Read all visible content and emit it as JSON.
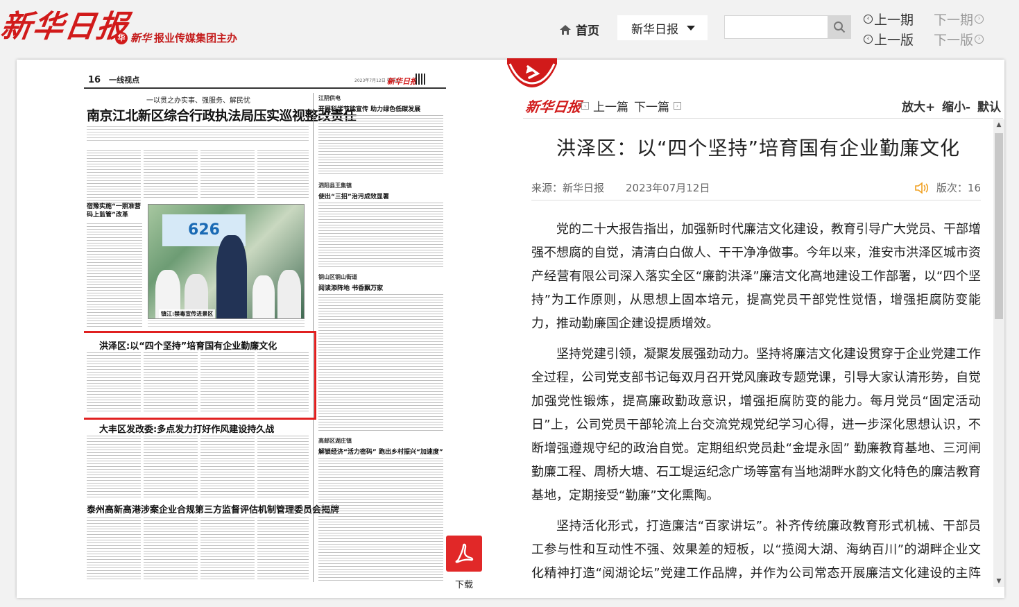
{
  "header": {
    "logo": "新华日报",
    "sponsor_brand": "新华",
    "sponsor_text": "报业传媒集团主办",
    "home": "首页",
    "paper_selected": "新华日报",
    "search_placeholder": "",
    "prev_issue": "上一期",
    "next_issue": "下一期",
    "prev_page": "上一版",
    "next_page": "下一版"
  },
  "newspaper": {
    "page_number": "16",
    "section": "一线视点",
    "date": "2023年7月12日  星期三",
    "brand": "新华日报",
    "lead_subtitle": "一以贯之办实事、强服务、解民忧",
    "lead_title": "南京江北新区综合行政执法局压实巡视整改责任",
    "side_head_1_small": "江阴供电",
    "side_head_1": "开展科学节能宣传  助力绿色低碳发展",
    "side_head_2_small": "泗阳县王集镇",
    "side_head_2": "使出“三招”治污成效显著",
    "side_head_3_small": "铜山区铜山街道",
    "side_head_3": "阅读添阵地  书香飘万家",
    "side_head_4_small": "高邮区湖庄镇",
    "side_head_4": "解锁经济“活力密码”  跑出乡村振兴“加速度”",
    "left_box_title": "宿豫实施“一照准营\n码上监管”改革",
    "photo_sign": "626",
    "photo_caption": "镇江:禁毒宣传进景区",
    "highlight_title": "洪泽区:以“四个坚持”培育国有企业勤廉文化",
    "headline_3": "大丰区发改委:多点发力打好作风建设持久战",
    "headline_4": "泰州高新高港涉案企业合规第三方监督评估机制管理委员会揭牌"
  },
  "pdf": {
    "label": "下载"
  },
  "article_bar": {
    "logo": "新华日报",
    "prev": "上一篇",
    "next": "下一篇",
    "zoom_in": "放大+",
    "zoom_out": "缩小-",
    "default": "默认"
  },
  "article": {
    "title": "洪泽区：以“四个坚持”培育国有企业勤廉文化",
    "source": "来源：新华日报",
    "date": "2023年07月12日",
    "edition": "版次：16",
    "paragraphs": [
      "党的二十大报告指出，加强新时代廉洁文化建设，教育引导广大党员、干部增强不想腐的自觉，清清白白做人、干干净净做事。今年以来，淮安市洪泽区城市资产经营有限公司深入落实全区“廉韵洪泽”廉洁文化高地建设工作部署，以“四个坚持”为工作原则，从思想上固本培元，提高党员干部党性觉悟，增强拒腐防变能力，推动勤廉国企建设提质增效。",
      "坚持党建引领，凝聚发展强劲动力。坚持将廉洁文化建设贯穿于企业党建工作全过程，公司党支部书记每双月召开党风廉政专题党课，引导大家认清形势，自觉加强党性锻炼，提高廉政勤政意识，增强拒腐防变的能力。每月党员“固定活动日”上，公司党员干部轮流上台交流党规党纪学习心得，进一步深化思想认识，不断增强遵规守纪的政治自觉。定期组织党员赴“金堤永固” 勤廉教育基地、三河闸勤廉工程、周桥大塘、石工堤运纪念广场等富有当地湖畔水韵文化特色的廉洁教育基地，定期接受“勤廉”文化熏陶。",
      "坚持活化形式，打造廉洁“百家讲坛”。补齐传统廉政教育形式机械、干部员工参与性和互动性不强、效果差的短板，以“揽阅大湖、海纳百川”的湖畔企业文化精神打造“阅湖论坛”党建工作品牌，并作为公司常态开展廉洁文化建设的主阵地。"
    ]
  },
  "colors": {
    "brand_red": "#d11a1a",
    "highlight_red": "#e02020",
    "pdf_red": "#e12828",
    "speaker_orange": "#f0a020"
  }
}
